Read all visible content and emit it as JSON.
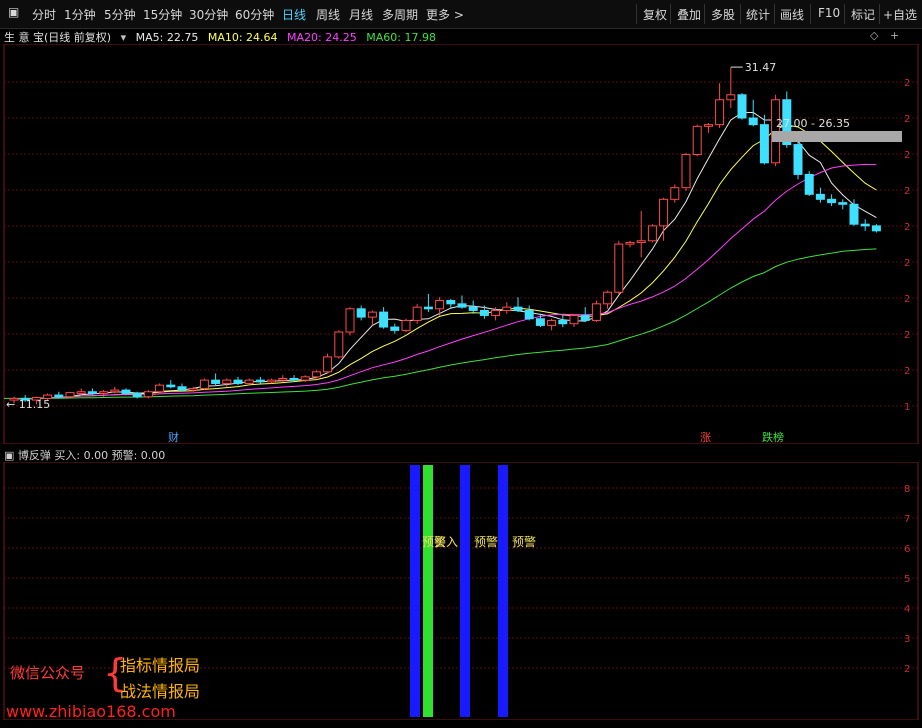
{
  "toolbar": {
    "left_tabs": [
      "分时",
      "1分钟",
      "5分钟",
      "15分钟",
      "30分钟",
      "60分钟",
      "日线",
      "周线",
      "月线",
      "多周期",
      "更多 >"
    ],
    "active_tab": "日线",
    "right_buttons": [
      "复权",
      "叠加",
      "多股",
      "统计",
      "画线",
      "F10",
      "标记",
      "+自选"
    ]
  },
  "main_chart": {
    "title": "生 意 宝(日线 前复权)",
    "ma_labels": [
      {
        "text": "MA5: 22.75",
        "color": "#e8e8e8"
      },
      {
        "text": "MA10: 24.64",
        "color": "#ffff50"
      },
      {
        "text": "MA20: 24.25",
        "color": "#ff40ff"
      },
      {
        "text": "MA60: 17.98",
        "color": "#40e040"
      }
    ],
    "high_label": "31.47",
    "low_label": "11.15",
    "range_label": "27.00 - 26.35",
    "markers": [
      {
        "text": "财",
        "color": "#4fa0ff"
      },
      {
        "text": "涨",
        "color": "#ff4040"
      },
      {
        "text": "跌榜",
        "color": "#40e040"
      }
    ],
    "colors": {
      "up": "#ff4a4a",
      "down": "#3fe0ff",
      "ma5": "#e8e8e8",
      "ma10": "#ffff50",
      "ma20": "#ff40ff",
      "ma60": "#40e040"
    }
  },
  "chart_data": {
    "type": "candlestick",
    "title": "生 意 宝(日线 前复权)",
    "series_ohlc": [
      [
        11.4,
        11.6,
        11.2,
        11.5
      ],
      [
        11.5,
        11.7,
        11.3,
        11.4
      ],
      [
        11.4,
        11.6,
        11.15,
        11.55
      ],
      [
        11.5,
        11.8,
        11.4,
        11.7
      ],
      [
        11.7,
        11.9,
        11.5,
        11.6
      ],
      [
        11.6,
        11.9,
        11.5,
        11.85
      ],
      [
        11.8,
        12.1,
        11.7,
        11.9
      ],
      [
        11.9,
        12.1,
        11.7,
        11.8
      ],
      [
        11.8,
        12.0,
        11.6,
        11.9
      ],
      [
        11.9,
        12.2,
        11.8,
        12.0
      ],
      [
        12.0,
        12.1,
        11.7,
        11.8
      ],
      [
        11.8,
        11.9,
        11.5,
        11.6
      ],
      [
        11.6,
        12.0,
        11.5,
        11.9
      ],
      [
        11.9,
        12.4,
        11.8,
        12.3
      ],
      [
        12.3,
        12.6,
        12.1,
        12.2
      ],
      [
        12.2,
        12.4,
        11.9,
        12.0
      ],
      [
        12.0,
        12.2,
        11.9,
        12.1
      ],
      [
        12.1,
        12.7,
        12.0,
        12.6
      ],
      [
        12.6,
        13.0,
        12.3,
        12.4
      ],
      [
        12.4,
        12.7,
        12.2,
        12.6
      ],
      [
        12.6,
        12.8,
        12.3,
        12.4
      ],
      [
        12.4,
        12.7,
        12.3,
        12.6
      ],
      [
        12.6,
        12.8,
        12.4,
        12.5
      ],
      [
        12.5,
        12.7,
        12.4,
        12.6
      ],
      [
        12.6,
        12.9,
        12.5,
        12.7
      ],
      [
        12.7,
        12.9,
        12.5,
        12.6
      ],
      [
        12.6,
        12.9,
        12.5,
        12.8
      ],
      [
        12.8,
        13.2,
        12.7,
        13.1
      ],
      [
        13.1,
        14.2,
        13.0,
        14.0
      ],
      [
        14.0,
        15.6,
        13.9,
        15.5
      ],
      [
        15.5,
        17.0,
        15.3,
        16.9
      ],
      [
        16.9,
        17.1,
        16.2,
        16.4
      ],
      [
        16.4,
        16.8,
        15.9,
        16.7
      ],
      [
        16.7,
        17.0,
        15.7,
        15.8
      ],
      [
        15.8,
        16.0,
        15.4,
        15.6
      ],
      [
        15.6,
        16.3,
        15.5,
        16.2
      ],
      [
        16.2,
        17.2,
        16.0,
        17.0
      ],
      [
        17.0,
        17.8,
        16.7,
        16.9
      ],
      [
        16.9,
        17.6,
        16.5,
        17.4
      ],
      [
        17.4,
        17.5,
        16.9,
        17.2
      ],
      [
        17.2,
        17.7,
        16.9,
        17.0
      ],
      [
        17.0,
        17.4,
        16.6,
        16.8
      ],
      [
        16.8,
        17.1,
        16.3,
        16.5
      ],
      [
        16.5,
        17.0,
        16.2,
        16.8
      ],
      [
        16.8,
        17.3,
        16.6,
        17.0
      ],
      [
        17.0,
        17.6,
        16.7,
        16.8
      ],
      [
        16.8,
        17.1,
        16.2,
        16.3
      ],
      [
        16.3,
        16.6,
        15.8,
        15.9
      ],
      [
        15.9,
        16.3,
        15.6,
        16.2
      ],
      [
        16.2,
        16.5,
        15.8,
        16.0
      ],
      [
        16.0,
        16.6,
        15.8,
        16.5
      ],
      [
        16.5,
        17.0,
        16.1,
        16.2
      ],
      [
        16.2,
        17.4,
        16.1,
        17.2
      ],
      [
        17.2,
        18.0,
        16.9,
        17.9
      ],
      [
        17.9,
        21.0,
        17.8,
        20.8
      ],
      [
        20.8,
        21.0,
        20.6,
        20.9
      ],
      [
        20.9,
        22.8,
        20.0,
        21.0
      ],
      [
        21.0,
        22.0,
        20.9,
        21.9
      ],
      [
        21.9,
        23.6,
        21.0,
        23.5
      ],
      [
        23.5,
        24.4,
        23.3,
        24.2
      ],
      [
        24.2,
        26.3,
        24.0,
        26.2
      ],
      [
        26.2,
        28.0,
        26.1,
        27.9
      ],
      [
        27.9,
        28.1,
        27.5,
        28.0
      ],
      [
        28.0,
        30.5,
        27.8,
        29.5
      ],
      [
        29.5,
        31.47,
        29.0,
        29.8
      ],
      [
        29.8,
        29.9,
        28.3,
        28.4
      ],
      [
        28.4,
        29.5,
        27.9,
        28.0
      ],
      [
        28.0,
        28.6,
        25.6,
        25.7
      ],
      [
        25.7,
        29.8,
        25.5,
        29.5
      ],
      [
        29.5,
        30.0,
        26.6,
        26.8
      ],
      [
        26.8,
        27.4,
        24.7,
        25.0
      ],
      [
        25.0,
        25.2,
        23.7,
        23.8
      ],
      [
        23.8,
        24.2,
        23.3,
        23.5
      ],
      [
        23.5,
        23.8,
        23.1,
        23.3
      ],
      [
        23.3,
        23.5,
        22.9,
        23.2
      ],
      [
        23.2,
        23.5,
        21.9,
        22.0
      ],
      [
        22.0,
        22.3,
        21.6,
        21.9
      ],
      [
        21.9,
        22.0,
        21.5,
        21.6
      ]
    ],
    "ylim": [
      10.8,
      32.5
    ],
    "indicator": {
      "name": "博反弹",
      "labels": [
        "买入: 0.00",
        "预警: 0.00"
      ],
      "bars": [
        {
          "index": 52,
          "value": 100,
          "color": "#1a1aff"
        },
        {
          "index": 53,
          "value": 100,
          "color": "#30e030"
        },
        {
          "index": 56,
          "value": 100,
          "color": "#1a1aff"
        },
        {
          "index": 59,
          "value": 100,
          "color": "#1a1aff"
        }
      ],
      "text_labels": [
        "预警",
        "买入",
        "预警",
        "预警"
      ],
      "ylim": [
        0,
        100
      ]
    }
  },
  "watermark": {
    "line1": "微信公众号",
    "brace": "{",
    "line2": "指标情报局",
    "line3": "战法情报局",
    "url": "www.zhibiao168.com"
  }
}
